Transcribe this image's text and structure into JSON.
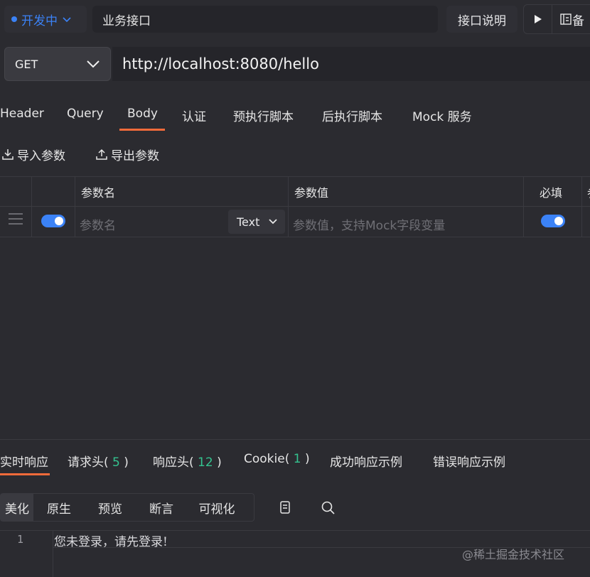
{
  "top": {
    "status": "开发中",
    "api_name": "业务接口",
    "doc_button": "接口说明",
    "save_button": "备"
  },
  "request": {
    "method": "GET",
    "url": "http://localhost:8080/hello"
  },
  "tabs": [
    "Header",
    "Query",
    "Body",
    "认证",
    "预执行脚本",
    "后执行脚本",
    "Mock 服务"
  ],
  "active_tab": "Body",
  "actions": {
    "import": "导入参数",
    "export": "导出参数"
  },
  "table": {
    "headers": {
      "name": "参数名",
      "value": "参数值",
      "required": "必填",
      "extra": "参"
    },
    "row": {
      "name_placeholder": "参数名",
      "type": "Text",
      "value_placeholder": "参数值，支持Mock字段变量",
      "enabled": true,
      "required": true
    }
  },
  "response_tabs": [
    {
      "label": "实时响应"
    },
    {
      "label": "请求头(",
      "count": "5",
      "suffix": ")"
    },
    {
      "label": "响应头(",
      "count": "12",
      "suffix": ")"
    },
    {
      "label": "Cookie(",
      "count": "1",
      "suffix": ")"
    },
    {
      "label": "成功响应示例"
    },
    {
      "label": "错误响应示例"
    }
  ],
  "format_buttons": [
    "美化",
    "原生",
    "预览",
    "断言",
    "可视化"
  ],
  "response_body": {
    "line_number": "1",
    "text": "您未登录，请先登录!"
  },
  "watermark": "@稀土掘金技术社区",
  "colors": {
    "accent_blue": "#3b82f6",
    "accent_orange": "#f26b3a",
    "count_green": "#34c38f"
  }
}
